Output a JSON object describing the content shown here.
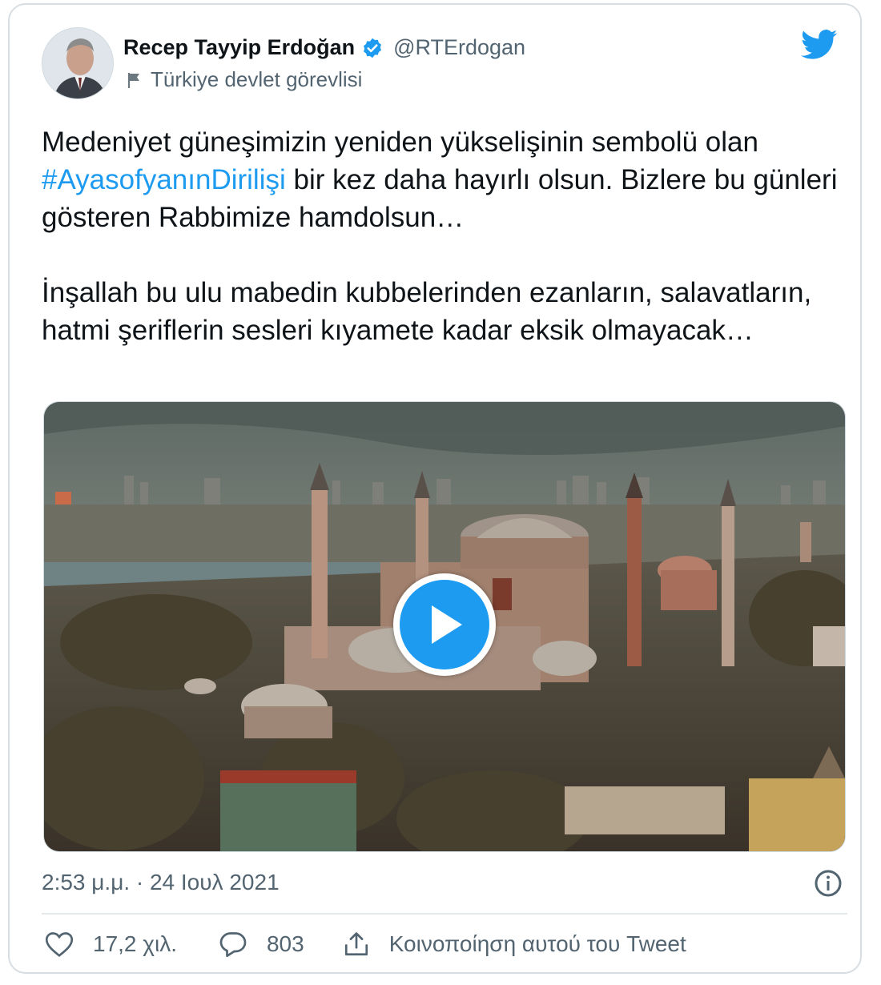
{
  "user": {
    "name": "Recep Tayyip Erdoğan",
    "handle": "@RTErdogan",
    "label": "Türkiye devlet görevlisi"
  },
  "tweet": {
    "line1_before": "Medeniyet güneşimizin yeniden yükselişinin sembolü olan ",
    "hashtag": "#AyasofyanınDirilişi",
    "line1_after": " bir kez daha hayırlı olsun. Bizlere bu günleri gösteren Rabbimize hamdolsun…",
    "paragraph2": "İnşallah bu ulu mabedin kubbelerinden ezanların, salavatların, hatmi şeriflerin sesleri kıyamete kadar eksik olmayacak…"
  },
  "timestamp": "2:53 μ.μ. · 24 Ιουλ 2021",
  "actions": {
    "likes": "17,2 χιλ.",
    "replies": "803",
    "share": "Κοινοποίηση αυτού του Tweet"
  },
  "icons": {
    "verified": "verified-badge-icon",
    "label": "flag-icon",
    "brand": "twitter-bird-icon",
    "play": "play-icon",
    "info": "info-icon",
    "like": "heart-icon",
    "reply": "speech-bubble-icon",
    "share": "share-upload-icon"
  },
  "colors": {
    "accent": "#1d9bf0",
    "text": "#0f1419",
    "secondary": "#536471",
    "border": "#d8dde2"
  }
}
